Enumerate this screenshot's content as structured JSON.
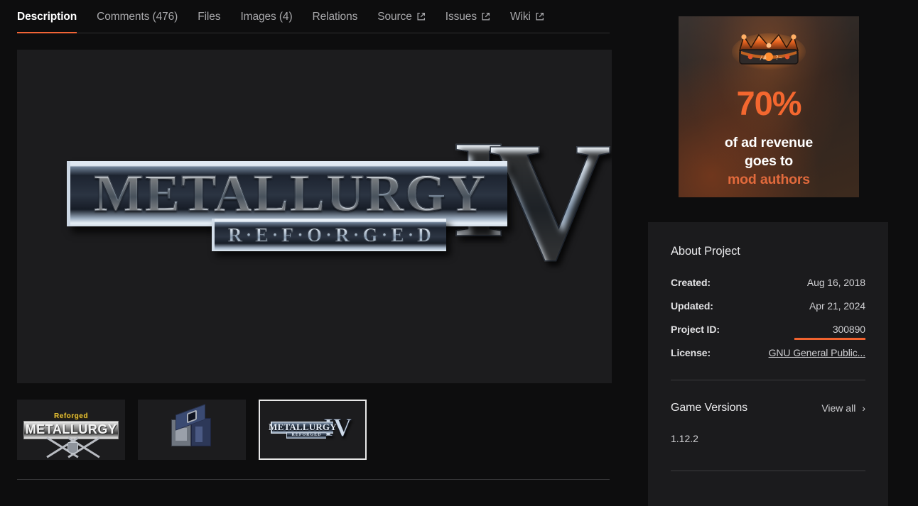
{
  "tabs": [
    {
      "label": "Description",
      "active": true,
      "external": false
    },
    {
      "label": "Comments (476)",
      "active": false,
      "external": false
    },
    {
      "label": "Files",
      "active": false,
      "external": false
    },
    {
      "label": "Images (4)",
      "active": false,
      "external": false
    },
    {
      "label": "Relations",
      "active": false,
      "external": false
    },
    {
      "label": "Source",
      "active": false,
      "external": true
    },
    {
      "label": "Issues",
      "active": false,
      "external": true
    },
    {
      "label": "Wiki",
      "active": false,
      "external": true
    }
  ],
  "hero": {
    "title_text": "METALLURGY",
    "subtitle_text": "R·E·F·O·R·G·E·D",
    "numeral_i": "I",
    "numeral_v": "V",
    "alt": "Metallurgy Reforged IV logo"
  },
  "thumbnails": [
    {
      "selected": false,
      "title": "METALLURGY",
      "sub": "Reforged",
      "alt": "Metallurgy Reforged banner with crossed swords"
    },
    {
      "selected": false,
      "alt": "Blue ore block render"
    },
    {
      "selected": true,
      "title": "METALLURGY",
      "sub": "REFORGED",
      "numeral": "IV",
      "alt": "Metallurgy Reforged IV logo thumbnail"
    }
  ],
  "ad": {
    "percent": "70%",
    "line1": "of ad revenue",
    "line2": "goes to",
    "line3": "mod authors",
    "icon": "crown-icon",
    "accent_color": "#f4672f",
    "highlight_color": "#e26a3c"
  },
  "about": {
    "title": "About Project",
    "rows": [
      {
        "label": "Created:",
        "value": "Aug 16, 2018",
        "link": false,
        "highlight": false
      },
      {
        "label": "Updated:",
        "value": "Apr 21, 2024",
        "link": false,
        "highlight": false
      },
      {
        "label": "Project ID:",
        "value": "300890",
        "link": false,
        "highlight": true
      },
      {
        "label": "License:",
        "value": "GNU General Public...",
        "link": true,
        "highlight": false
      }
    ]
  },
  "game_versions": {
    "title": "Game Versions",
    "view_all": "View all",
    "chevron": "›",
    "versions": [
      "1.12.2"
    ]
  },
  "colors": {
    "accent": "#f16436",
    "page_bg": "#0d0d0e",
    "card_bg": "#1b1b1d",
    "media_bg": "#1c1c1e",
    "divider": "#3b3b3d"
  }
}
